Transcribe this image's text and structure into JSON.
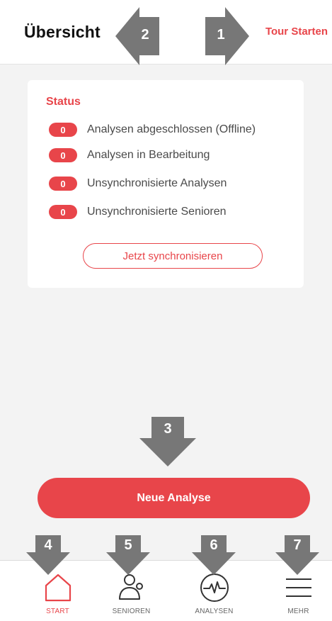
{
  "header": {
    "title": "Übersicht",
    "tour_link": "Tour Starten"
  },
  "status_card": {
    "heading": "Status",
    "rows": [
      {
        "count": "0",
        "label": "Analysen abgeschlossen (Offline)"
      },
      {
        "count": "0",
        "label": "Analysen in Bearbeitung"
      },
      {
        "count": "0",
        "label": "Unsynchronisierte Analysen"
      },
      {
        "count": "0",
        "label": "Unsynchronisierte Senioren"
      }
    ],
    "sync_button": "Jetzt synchronisieren"
  },
  "main": {
    "new_analysis_button": "Neue Analyse"
  },
  "bottom_nav": {
    "items": [
      {
        "label": "START",
        "icon": "home-icon",
        "active": true
      },
      {
        "label": "SENIOREN",
        "icon": "seniors-icon",
        "active": false
      },
      {
        "label": "ANALYSEN",
        "icon": "pulse-icon",
        "active": false
      },
      {
        "label": "MEHR",
        "icon": "menu-icon",
        "active": false
      }
    ]
  },
  "tour_callouts": [
    "1",
    "2",
    "3",
    "4",
    "5",
    "6",
    "7"
  ],
  "colors": {
    "accent": "#e8454a",
    "background": "#f3f3f3",
    "callout": "#777777"
  }
}
